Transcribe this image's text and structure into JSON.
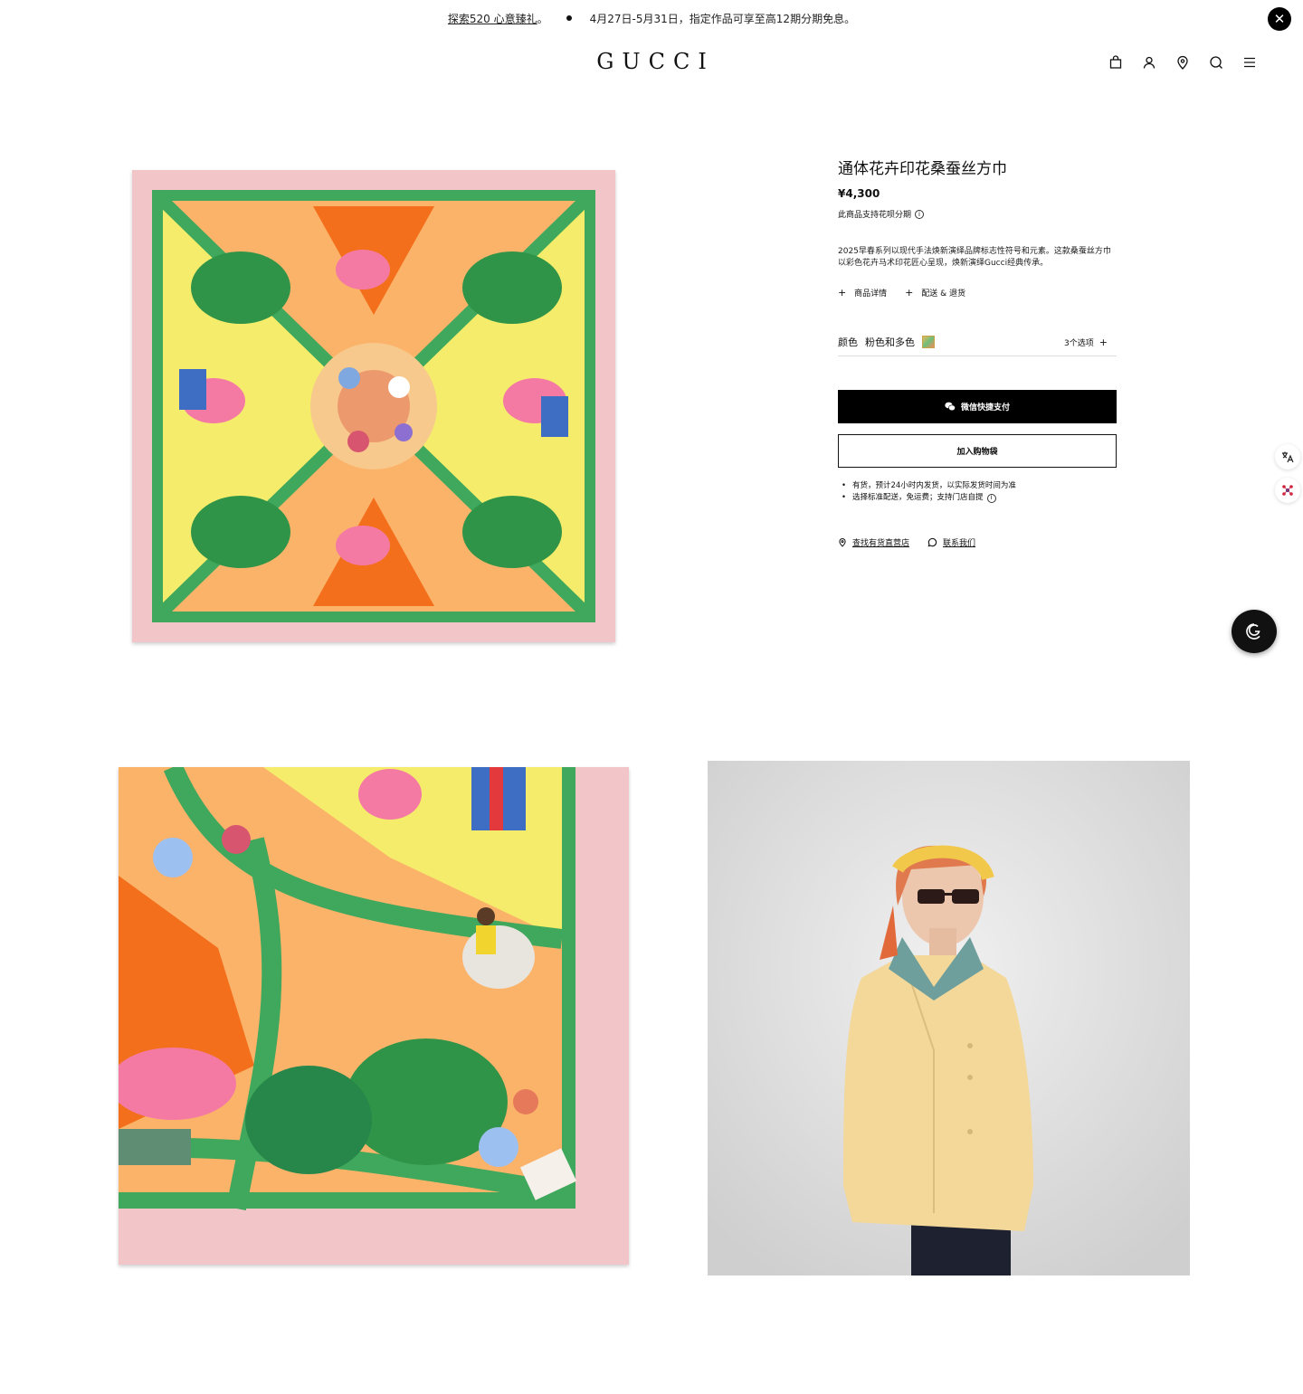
{
  "promo": {
    "link_text": "探索520 心意臻礼",
    "link_suffix": "。",
    "message": "4月27日-5月31日，指定作品可享至高12期分期免息。"
  },
  "header": {
    "logo": "GUCCI",
    "icons": [
      "shopping-bag-icon",
      "account-icon",
      "location-pin-icon",
      "search-icon",
      "menu-icon"
    ]
  },
  "product": {
    "title": "通体花卉印花桑蚕丝方巾",
    "price": "¥4,300",
    "installment": "此商品支持花呗分期",
    "description": "2025早春系列以现代手法焕新演绎品牌标志性符号和元素。这款桑蚕丝方巾以彩色花卉马术印花匠心呈现，焕新演绎Gucci经典传承。",
    "details_label": "商品详情",
    "shipping_label": "配送 & 退货",
    "color_label": "颜色",
    "color_value": "粉色和多色",
    "options_label": "3个选项",
    "wechat_pay_label": "微信快捷支付",
    "add_to_cart_label": "加入购物袋",
    "stock_line_1": "有货，预计24小时内发货，以实际发货时间为准",
    "stock_line_2": "选择标准配送，免运费；支持门店自提",
    "find_store_label": "查找有货直营店",
    "contact_label": "联系我们"
  },
  "colors": {
    "scarf_pink": "#f2c6c8",
    "scarf_orange": "#f79a45",
    "scarf_yellow": "#f4ec6a",
    "scarf_green": "#3fa85c",
    "backdrop_grey": "#d8d8d8",
    "coat_yellow": "#f3d89a"
  }
}
